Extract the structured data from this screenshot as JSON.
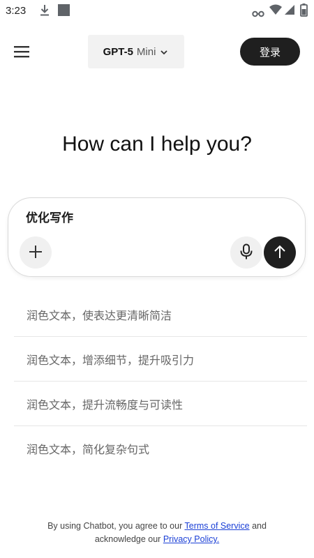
{
  "status_bar": {
    "time": "3:23",
    "icons": [
      "download-icon",
      "square-notification-icon",
      "vpn-key-icon",
      "wifi-icon",
      "signal-icon",
      "battery-icon"
    ]
  },
  "header": {
    "menu_icon": "hamburger-menu-icon",
    "model": {
      "name": "GPT-5",
      "variant": "Mini",
      "dropdown_icon": "chevron-down-icon"
    },
    "login_label": "登录"
  },
  "main": {
    "greeting": "How can I help you?"
  },
  "composer": {
    "text": "优化写作",
    "add_icon": "plus-icon",
    "mic_icon": "microphone-icon",
    "send_icon": "arrow-up-icon"
  },
  "suggestions": [
    "润色文本，使表达更清晰简洁",
    "润色文本，增添细节，提升吸引力",
    "润色文本，提升流畅度与可读性",
    "润色文本，简化复杂句式"
  ],
  "footer": {
    "prefix": "By using Chatbot, you agree to our",
    "terms_link": "Terms of Service",
    "middle": "and",
    "line2_prefix": "acknowledge our",
    "privacy_link": "Privacy Policy."
  },
  "colors": {
    "accent_dark": "#1f1f1f",
    "link": "#1a3fd6",
    "chip_bg": "#f2f2f2"
  }
}
